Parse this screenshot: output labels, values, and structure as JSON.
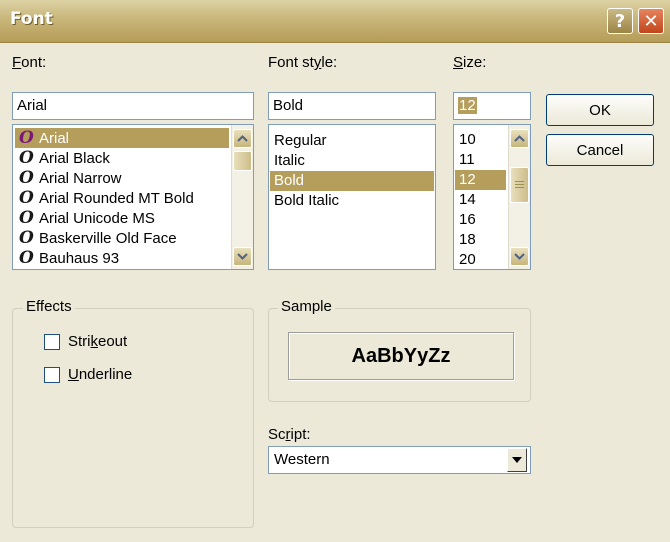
{
  "window": {
    "title": "Font",
    "help_glyph": "?",
    "close_glyph": "✕"
  },
  "font": {
    "label_u": "F",
    "label_rest": "ont:",
    "value": "Arial",
    "items": [
      "Arial",
      "Arial Black",
      "Arial Narrow",
      "Arial Rounded MT Bold",
      "Arial Unicode MS",
      "Baskerville Old Face",
      "Bauhaus 93"
    ],
    "icon": "O",
    "selected_index": 0
  },
  "style": {
    "label_pre": "Font st",
    "label_u": "y",
    "label_post": "le:",
    "value": "Bold",
    "items": [
      "Regular",
      "Italic",
      "Bold",
      "Bold Italic"
    ],
    "selected_index": 2
  },
  "size": {
    "label_u": "S",
    "label_rest": "ize:",
    "value": "12",
    "items": [
      "10",
      "11",
      "12",
      "14",
      "16",
      "18",
      "20"
    ],
    "selected_index": 2
  },
  "buttons": {
    "ok": "OK",
    "cancel": "Cancel"
  },
  "effects": {
    "legend": "Effects",
    "strikeout_pre": "Stri",
    "strikeout_u": "k",
    "strikeout_post": "eout",
    "underline_u": "U",
    "underline_rest": "nderline",
    "strikeout_checked": false,
    "underline_checked": false
  },
  "sample": {
    "legend": "Sample",
    "text": "AaBbYyZz"
  },
  "script": {
    "label_pre": "Sc",
    "label_u": "r",
    "label_post": "ipt:",
    "value": "Western"
  },
  "colors": {
    "selection": "#b59d5b",
    "titlebar": "#c8b67a",
    "face": "#ece9d8"
  }
}
